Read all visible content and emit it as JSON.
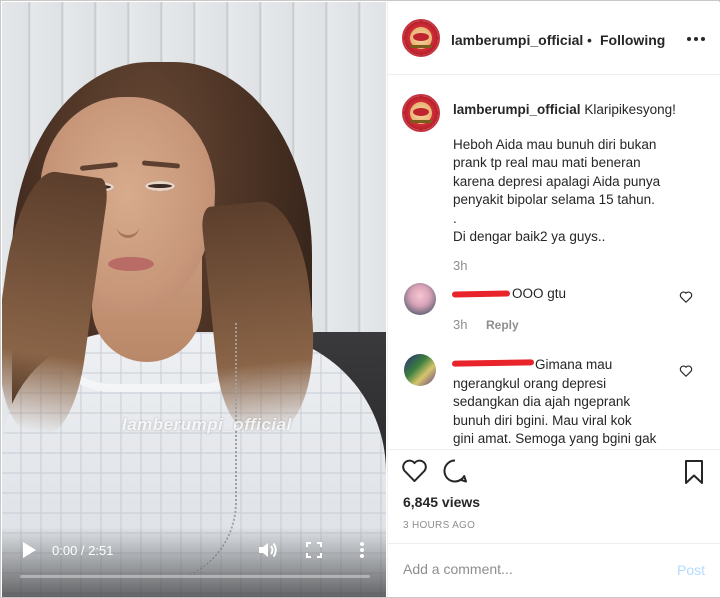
{
  "video": {
    "watermark": "lamberumpi_official",
    "time": "0:00 / 2:51",
    "progress_percent": 0
  },
  "header": {
    "username": "lamberumpi_official",
    "separator": "•",
    "follow_status": "Following"
  },
  "caption": {
    "username": "lamberumpi_official",
    "first_line": "Klaripikesyong!",
    "body": "Heboh Aida mau bunuh diri bukan\nprank tp real mau mati beneran\nkarena depresi apalagi Aida punya\npenyakit bipolar selama 15 tahun.\n.\nDi dengar baik2 ya guys..",
    "time": "3h"
  },
  "comments": [
    {
      "text": "OOO gtu",
      "time": "3h",
      "reply_label": "Reply"
    },
    {
      "text": "Gimana mau\nngerangkul orang depresi\nsedangkan dia ajah ngeprank\nbunuh diri bgini. Mau viral kok\ngini amat. Semoga yang bgini gak"
    }
  ],
  "footer": {
    "views": "6,845 views",
    "posted": "3 HOURS AGO",
    "comment_placeholder": "Add a comment...",
    "post_label": "Post"
  },
  "colors": {
    "redaction": "#e8232a",
    "post_disabled": "#b3dbff",
    "muted_text": "#8e8e8e"
  }
}
